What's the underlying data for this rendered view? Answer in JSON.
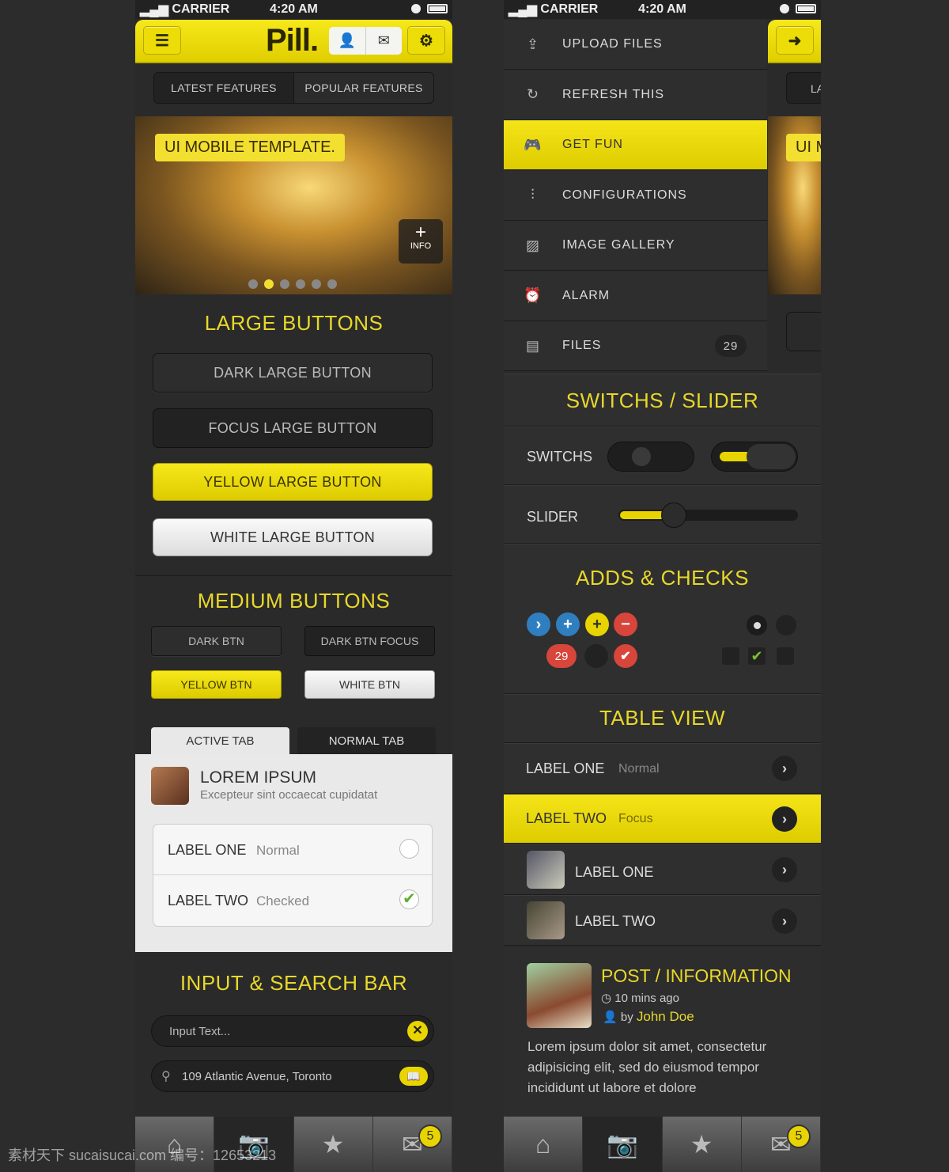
{
  "status": {
    "carrier": "CARRIER",
    "time": "4:20 AM"
  },
  "header": {
    "logo": "Pill.",
    "menu_icon": "menu-icon",
    "user_icon": "user-icon",
    "mail_icon": "mail-icon",
    "settings_icon": "gear-icon",
    "arrow_icon": "arrow-right-icon"
  },
  "segments": [
    "LATEST FEATURES",
    "POPULAR FEATURES"
  ],
  "hero": {
    "title": "UI MOBILE TEMPLATE.",
    "info": "INFO",
    "dots": 6,
    "active_dot": 2
  },
  "large_buttons": {
    "title": "LARGE BUTTONS",
    "dark": "DARK LARGE BUTTON",
    "focus": "FOCUS LARGE BUTTON",
    "yellow": "YELLOW LARGE BUTTON",
    "white": "WHITE LARGE BUTTON"
  },
  "medium_buttons": {
    "title": "MEDIUM BUTTONS",
    "dark": "DARK BTN",
    "dark_focus": "DARK BTN FOCUS",
    "yellow": "YELLOW BTN",
    "white": "WHITE BTN"
  },
  "tabs": {
    "active": "ACTIVE TAB",
    "normal": "NORMAL TAB"
  },
  "card": {
    "title": "LOREM IPSUM",
    "subtitle": "Excepteur sint occaecat cupidatat",
    "rows": [
      {
        "label": "LABEL ONE",
        "value": "Normal",
        "checked": false
      },
      {
        "label": "LABEL TWO",
        "value": "Checked",
        "checked": true
      }
    ]
  },
  "inputs": {
    "title": "INPUT & SEARCH BAR",
    "input_placeholder": "Input Text...",
    "search_value": "109 Atlantic Avenue, Toronto"
  },
  "tabbar": {
    "badge": "5",
    "items": [
      "home-icon",
      "camera-icon",
      "star-icon",
      "mail-icon"
    ],
    "active": 1
  },
  "side_menu": [
    {
      "icon": "upload-icon",
      "label": "UPLOAD FILES"
    },
    {
      "icon": "refresh-icon",
      "label": "REFRESH THIS"
    },
    {
      "icon": "gamepad-icon",
      "label": "GET FUN",
      "active": true
    },
    {
      "icon": "sliders-icon",
      "label": "CONFIGURATIONS"
    },
    {
      "icon": "image-icon",
      "label": "IMAGE GALLERY"
    },
    {
      "icon": "alarm-icon",
      "label": "ALARM"
    },
    {
      "icon": "file-icon",
      "label": "FILES",
      "count": "29"
    }
  ],
  "peek": {
    "tab": "LA",
    "hero": "UI M"
  },
  "switches": {
    "title": "SWITCHS / SLIDER",
    "switch_label": "SWITCHS",
    "slider_label": "SLIDER",
    "switch1_on": false,
    "switch2_on": true,
    "slider_value": 0.3
  },
  "adds": {
    "title": "ADDS & CHECKS",
    "count": "29"
  },
  "table": {
    "title": "TABLE VIEW",
    "rows": [
      {
        "label": "LABEL ONE",
        "value": "Normal"
      },
      {
        "label": "LABEL TWO",
        "value": "Focus",
        "focus": true
      },
      {
        "label": "LABEL ONE"
      },
      {
        "label": "LABEL TWO"
      }
    ]
  },
  "post": {
    "title": "POST / INFORMATION",
    "time": "10 mins ago",
    "by": "by",
    "author": "John Doe",
    "body": "Lorem ipsum dolor sit amet, consectetur adipisicing elit, sed do eiusmod tempor incididunt ut labore et dolore"
  },
  "colors": {
    "accent": "#e8d82a",
    "background": "#2c2c2c",
    "danger": "#d8453a",
    "info": "#2f7fc0"
  },
  "watermark": "素材天下 sucaisucai.com  编号：12653213"
}
